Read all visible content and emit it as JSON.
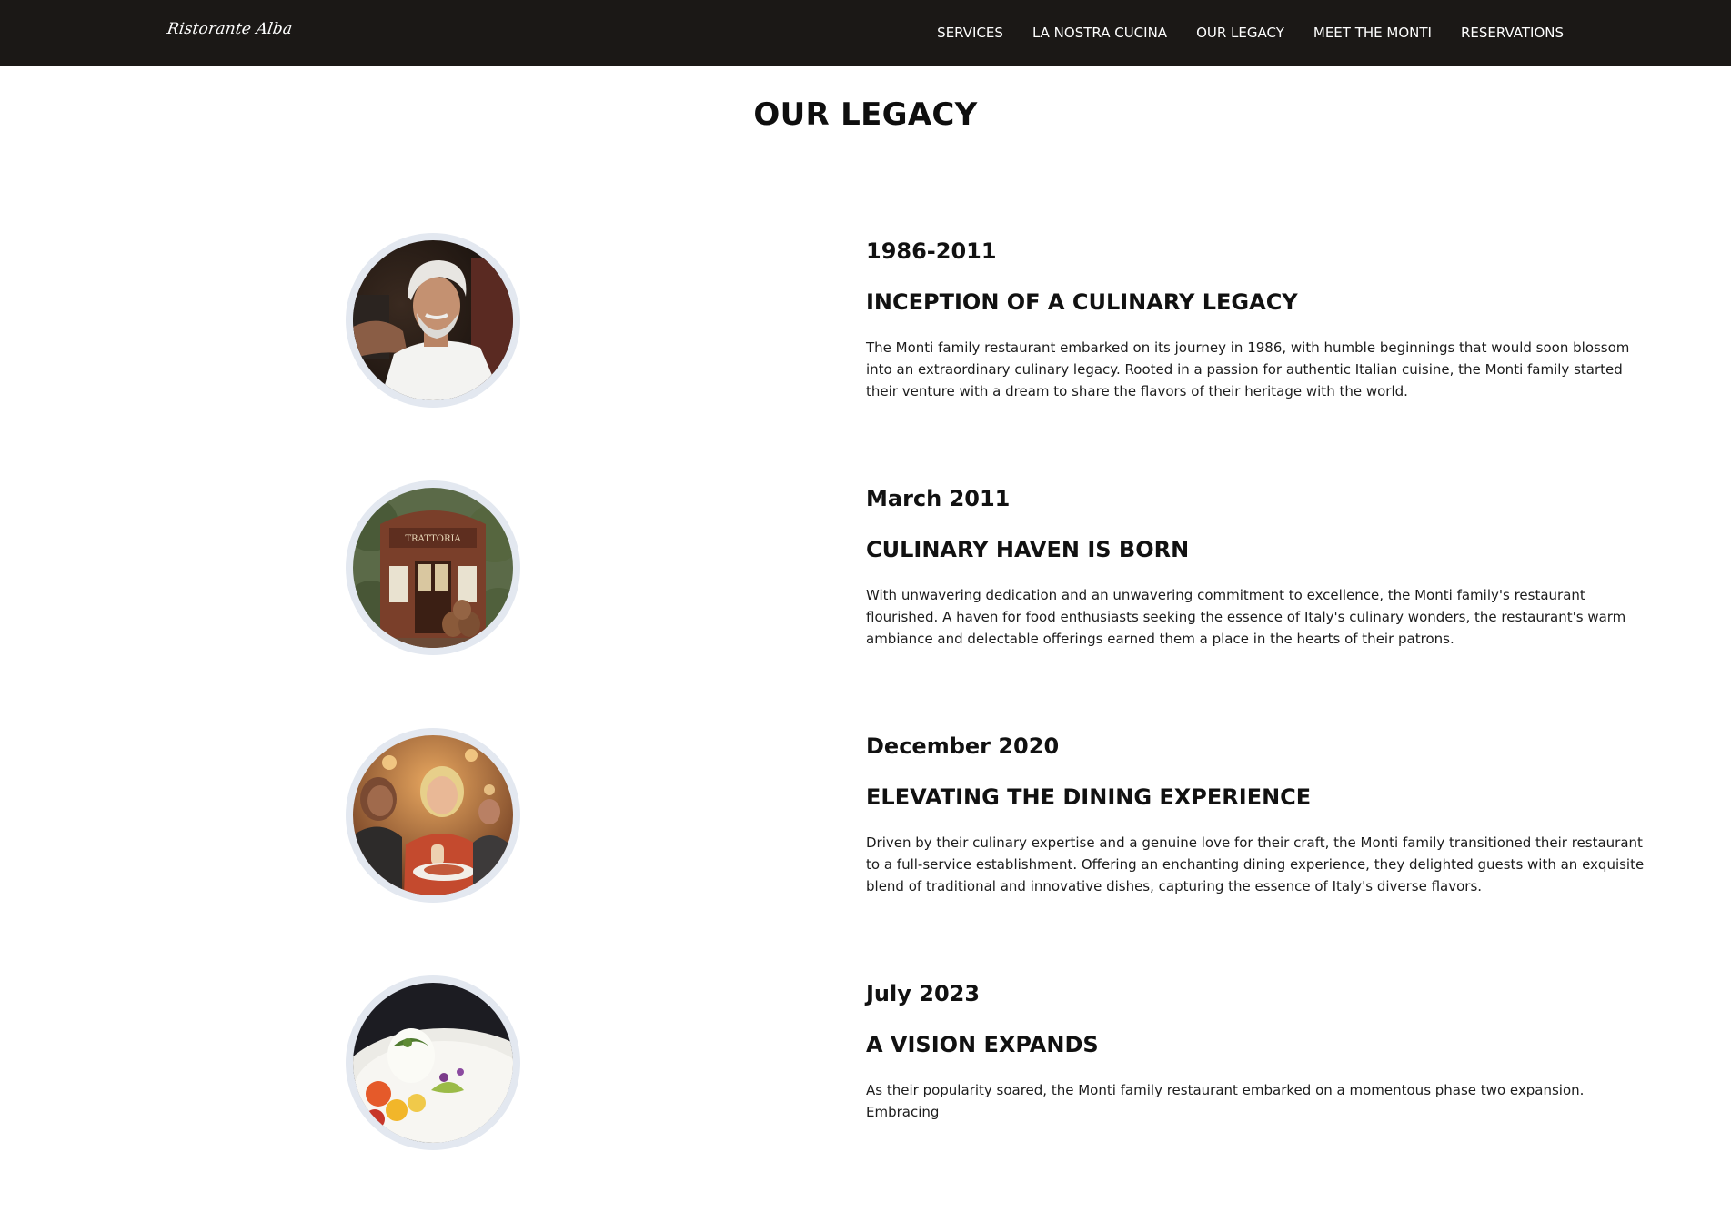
{
  "header": {
    "logo_text": "Ristorante Alba",
    "nav": [
      "SERVICES",
      "LA NOSTRA CUCINA",
      "OUR LEGACY",
      "MEET THE MONTI",
      "RESERVATIONS"
    ]
  },
  "page": {
    "title": "OUR LEGACY"
  },
  "timeline": [
    {
      "date": "1986-2011",
      "heading": "INCEPTION OF A CULINARY LEGACY",
      "text": "The Monti family restaurant embarked on its journey in 1986, with humble beginnings that would soon blossom into an extraordinary culinary legacy. Rooted in a passion for authentic Italian cuisine, the Monti family started their venture with a dream to share the flavors of their heritage with the world.",
      "image_alt": "elderly-chef-photo"
    },
    {
      "date": "March 2011",
      "heading": "CULINARY HAVEN IS BORN",
      "text": "With unwavering dedication and an unwavering commitment to excellence, the Monti family's restaurant flourished. A haven for food enthusiasts seeking the essence of Italy's culinary wonders, the restaurant's warm ambiance and delectable offerings earned them a place in the hearts of their patrons.",
      "image_alt": "trattoria-storefront-photo",
      "sign_text": "TRATTORIA"
    },
    {
      "date": "December 2020",
      "heading": "ELEVATING THE DINING EXPERIENCE",
      "text": "Driven by their culinary expertise and a genuine love for their craft, the Monti family transitioned their restaurant to a full-service establishment. Offering an enchanting dining experience, they delighted guests with an exquisite blend of traditional and innovative dishes, capturing the essence of Italy's diverse flavors.",
      "image_alt": "diners-eating-photo"
    },
    {
      "date": "July 2023",
      "heading": "A VISION EXPANDS",
      "text": "As their popularity soared, the Monti family restaurant embarked on a momentous phase two expansion. Embracing",
      "image_alt": "plated-burrata-dish-photo"
    }
  ]
}
